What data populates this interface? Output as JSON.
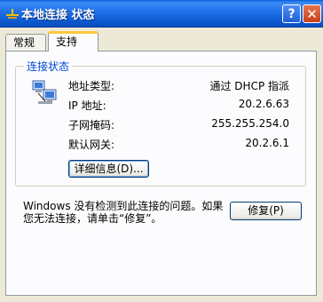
{
  "window": {
    "title": "本地连接 状态",
    "help_label": "?",
    "close_label": "✕"
  },
  "tabs": [
    {
      "label": "常规",
      "active": false
    },
    {
      "label": "支持",
      "active": true
    }
  ],
  "connection_status": {
    "legend": "连接状态",
    "rows": [
      {
        "label": "地址类型:",
        "value": "通过 DHCP 指派"
      },
      {
        "label": "IP 地址:",
        "value": "20.2.6.63"
      },
      {
        "label": "子网掩码:",
        "value": "255.255.254.0"
      },
      {
        "label": "默认网关:",
        "value": "20.2.6.1"
      }
    ],
    "details_button": "详细信息(D)..."
  },
  "footer": {
    "message": "Windows 没有检测到此连接的问题。如果\n您无法连接，请单击“修复”。",
    "repair_button": "修复(P)"
  },
  "icons": {
    "title": "network-connection-icon",
    "status": "network-computers-icon"
  }
}
